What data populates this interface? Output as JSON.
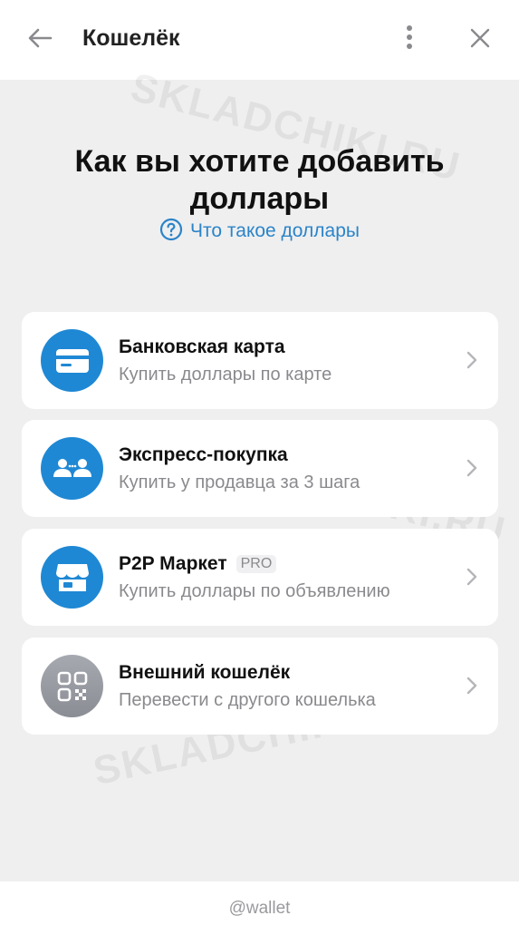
{
  "header": {
    "title": "Кошелёк"
  },
  "main": {
    "heading_line1": "Как вы хотите добавить",
    "heading_line2": "доллары",
    "help_link": "Что такое доллары",
    "options": [
      {
        "title": "Банковская карта",
        "subtitle": "Купить доллары по карте",
        "icon": "credit-card-icon"
      },
      {
        "title": "Экспресс-покупка",
        "subtitle": "Купить у продавца за 3 шага",
        "icon": "two-users-icon"
      },
      {
        "title": "P2P Маркет",
        "badge": "PRO",
        "subtitle": "Купить доллары по объявлению",
        "icon": "storefront-icon"
      },
      {
        "title": "Внешний кошелёк",
        "subtitle": "Перевести с другого кошелька",
        "icon": "qr-code-icon"
      }
    ]
  },
  "watermark": "SKLADCHIKI.RU",
  "footer": {
    "handle": "@wallet"
  },
  "colors": {
    "accent": "#1f88d4",
    "link": "#2b84c8",
    "background": "#efeff0"
  }
}
